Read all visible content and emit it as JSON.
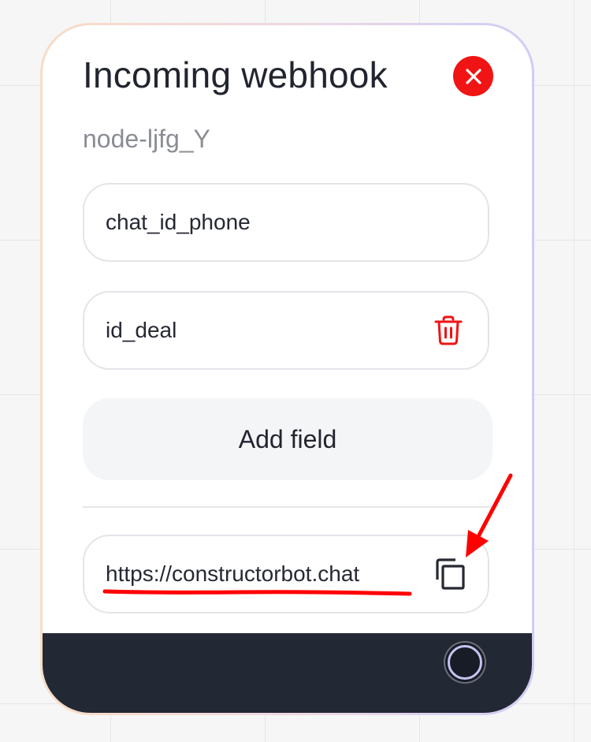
{
  "node": {
    "title": "Incoming webhook",
    "id": "node-ljfg_Y"
  },
  "fields": [
    {
      "value": "chat_id_phone"
    },
    {
      "value": "id_deal"
    }
  ],
  "buttons": {
    "add_field_label": "Add field"
  },
  "webhook": {
    "url": "https://constructorbot.chat"
  },
  "icons": {
    "close": "close-icon",
    "delete": "trash-icon",
    "copy": "copy-icon",
    "connector": "connector-handle-icon"
  },
  "colors": {
    "danger": "#f01414",
    "annotation": "#ff0000",
    "footer": "#232835",
    "border_left": "#f8dcc6",
    "border_right": "#cfcdf6"
  }
}
